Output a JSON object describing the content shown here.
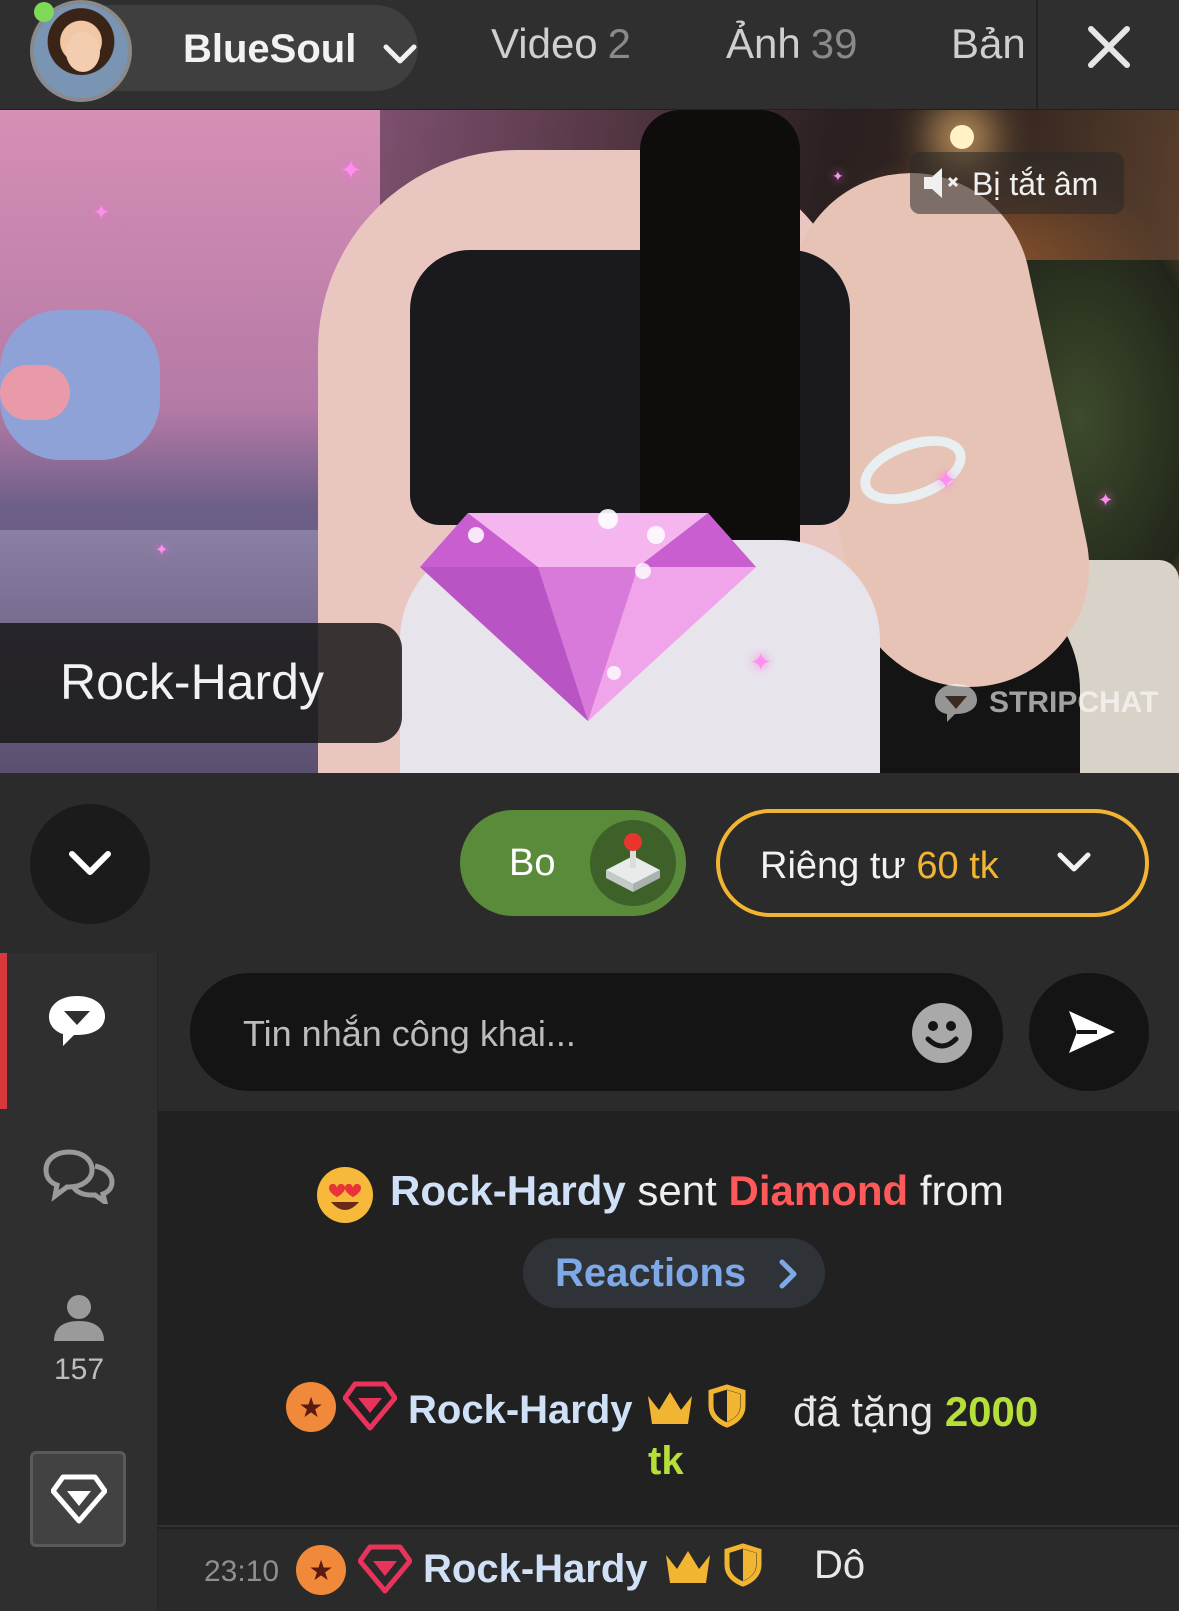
{
  "header": {
    "username": "BlueSoul",
    "online": true,
    "tabs": [
      {
        "label": "Video",
        "count": "2"
      },
      {
        "label": "Ảnh",
        "count": "39"
      },
      {
        "label": "Bản",
        "count": ""
      }
    ]
  },
  "video": {
    "muted_label": "Bị tắt âm",
    "gift_sender": "Rock-Hardy",
    "watermark": "STRIPCHAT"
  },
  "controls": {
    "tip_label": "Bo",
    "private_label": "Riêng tư",
    "private_price": "60 tk"
  },
  "sidebar": {
    "viewers_count": "157"
  },
  "chat": {
    "input_placeholder": "Tin nhắn công khai...",
    "messages": [
      {
        "user": "Rock-Hardy",
        "verb": "sent",
        "gift": "Diamond",
        "suffix": "from",
        "link_label": "Reactions"
      },
      {
        "user": "Rock-Hardy",
        "action": "đã tặng",
        "amount": "2000",
        "unit": "tk"
      },
      {
        "time": "23:10",
        "user": "Rock-Hardy",
        "text": "Dô"
      }
    ]
  },
  "colors": {
    "accent_gold": "#f2b531",
    "tip_green": "#5a8b3a",
    "gift_red": "#ff5a5a",
    "nick_blue": "#cfe0f7",
    "amount_green": "#b6df3a",
    "active_red": "#d9373b"
  }
}
